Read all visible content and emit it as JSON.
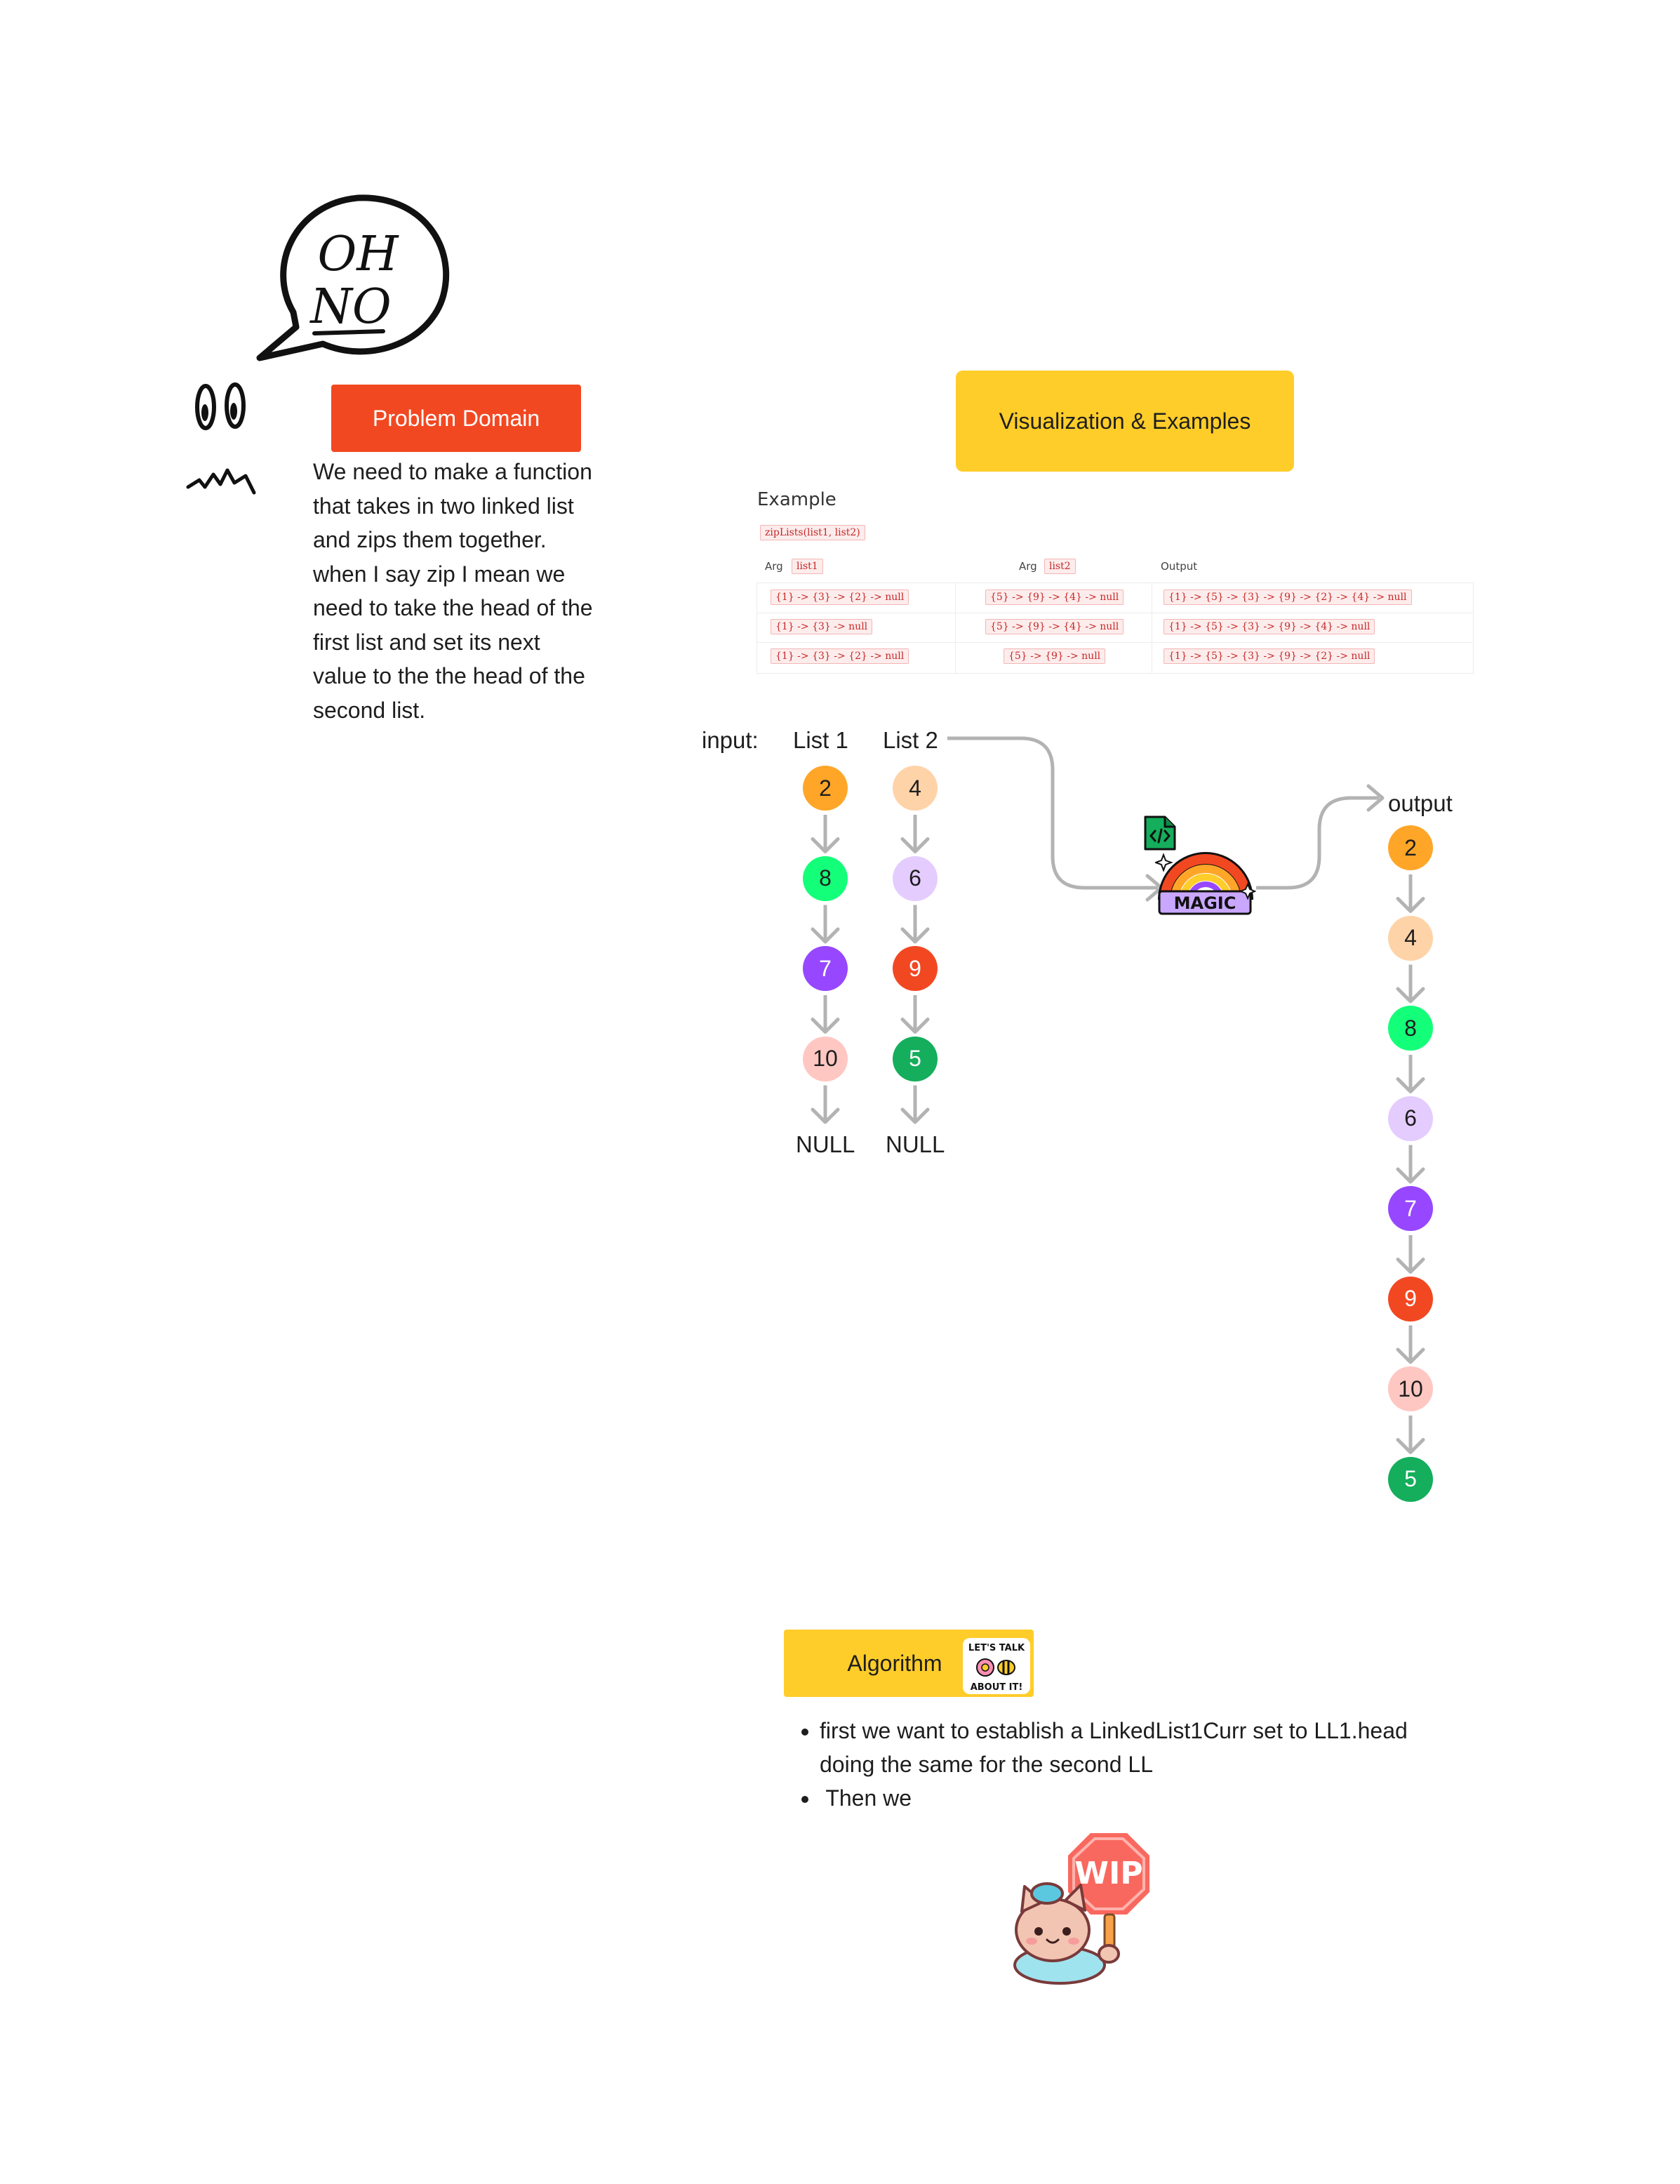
{
  "problem": {
    "title": "Problem Domain",
    "body": "We need to make a function that takes in two linked list and zips them together. when I say zip I mean we need to take the head of the first list and set its next value to the the head of the second list."
  },
  "stickers": {
    "oh_no_line1": "OH",
    "oh_no_line2": "NO",
    "magic": "MAGIC",
    "lets_talk_top": "LET'S TALK",
    "lets_talk_bottom": "ABOUT IT!",
    "wip": "WIP"
  },
  "visualization": {
    "title": "Visualization & Examples",
    "example_title": "Example",
    "call": "zipLists(list1, list2)",
    "headers": {
      "arg": "Arg",
      "list1": "list1",
      "list2": "list2",
      "output": "Output"
    },
    "rows": [
      {
        "list1": "{1} -> {3} -> {2} -> null",
        "list2": "{5} -> {9} -> {4} -> null",
        "output": "{1} -> {5} -> {3} -> {9} -> {2} -> {4} -> null"
      },
      {
        "list1": "{1} -> {3} -> null",
        "list2": "{5} -> {9} -> {4} -> null",
        "output": "{1} -> {5} -> {3} -> {9} -> {4} -> null"
      },
      {
        "list1": "{1} -> {3} -> {2} -> null",
        "list2": "{5} -> {9} -> null",
        "output": "{1} -> {5} -> {3} -> {9} -> {2} -> null"
      }
    ],
    "input_label": "input:",
    "list1_label": "List 1",
    "list2_label": "List 2",
    "output_label": "output",
    "null_label": "NULL",
    "list1_nodes": [
      {
        "value": "2",
        "color": "#ffa629"
      },
      {
        "value": "8",
        "color": "#14ff79"
      },
      {
        "value": "7",
        "color": "#9747ff"
      },
      {
        "value": "10",
        "color": "#ffc7c2"
      }
    ],
    "list2_nodes": [
      {
        "value": "4",
        "color": "#ffd3a8"
      },
      {
        "value": "6",
        "color": "#e4ccff"
      },
      {
        "value": "9",
        "color": "#f24822"
      },
      {
        "value": "5",
        "color": "#14ae5c"
      }
    ],
    "output_nodes": [
      {
        "value": "2",
        "color": "#ffa629"
      },
      {
        "value": "4",
        "color": "#ffd3a8"
      },
      {
        "value": "8",
        "color": "#14ff79"
      },
      {
        "value": "6",
        "color": "#e4ccff"
      },
      {
        "value": "7",
        "color": "#9747ff"
      },
      {
        "value": "9",
        "color": "#f24822"
      },
      {
        "value": "10",
        "color": "#ffc7c2"
      },
      {
        "value": "5",
        "color": "#14ae5c"
      }
    ]
  },
  "algorithm": {
    "title": "Algorithm",
    "steps": [
      "first we want to establish a LinkedList1Curr set to LL1.head doing the same for the second LL",
      " Then we"
    ]
  }
}
